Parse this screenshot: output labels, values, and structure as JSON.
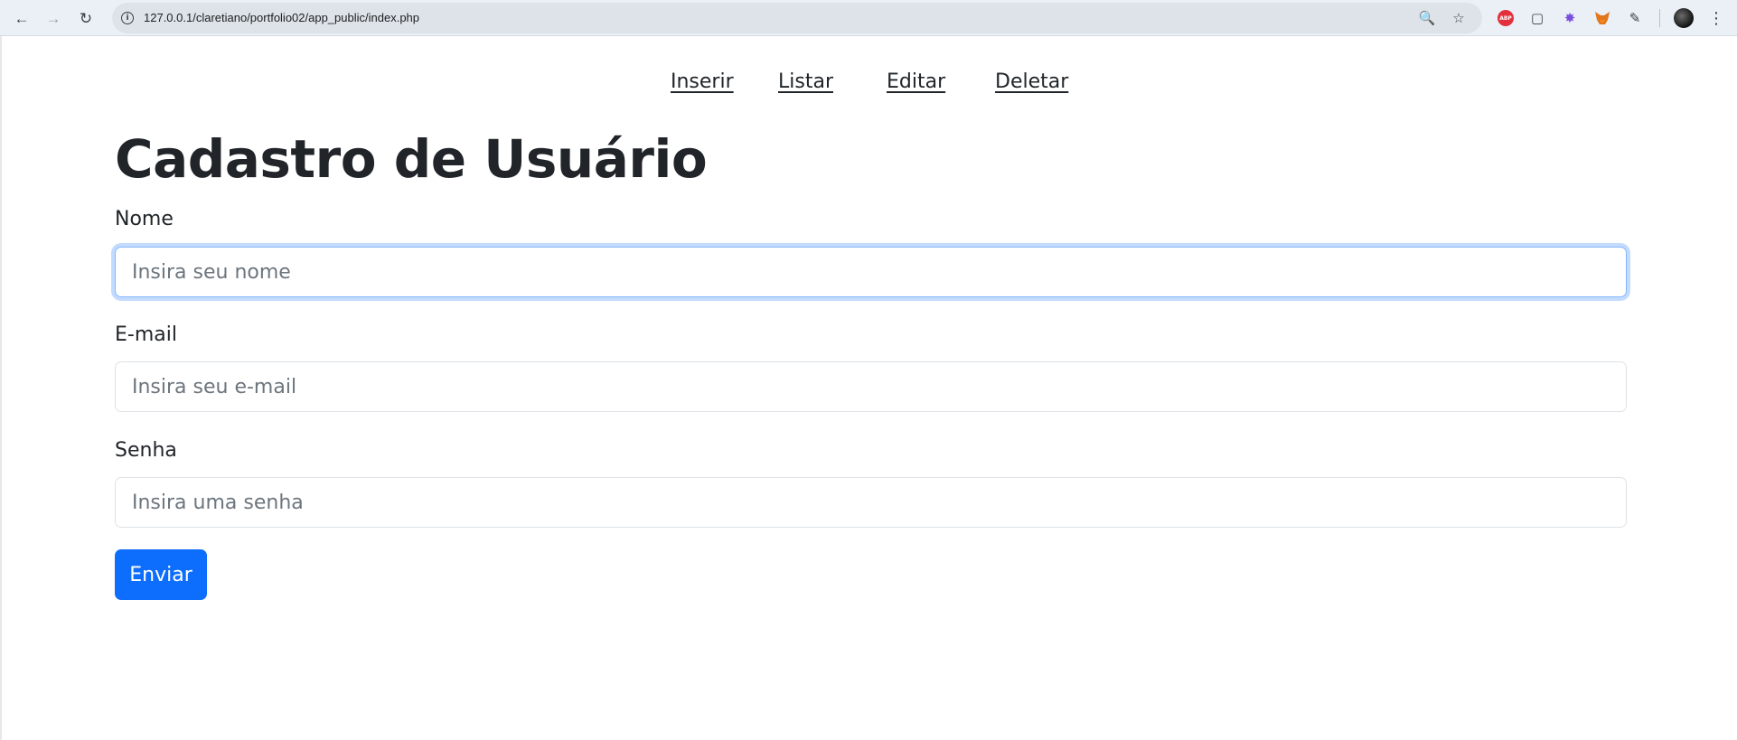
{
  "browser": {
    "url": "127.0.0.1/claretiano/portfolio02/app_public/index.php",
    "icons": {
      "back": "arrow-left-icon",
      "forward": "arrow-right-icon",
      "reload": "reload-icon",
      "site_info": "info-icon",
      "zoom": "zoom-icon",
      "bookmark": "star-icon",
      "extensions": [
        "adblock-plus-icon",
        "screenshot-icon",
        "flower-extension-icon",
        "metamask-fox-icon",
        "puzzle-icon"
      ],
      "profile": "avatar",
      "menu": "kebab-menu-icon"
    },
    "abp_text": "ABP"
  },
  "nav": {
    "links": [
      {
        "label": "Inserir"
      },
      {
        "label": "Listar"
      },
      {
        "label": "Editar"
      },
      {
        "label": "Deletar"
      }
    ]
  },
  "page": {
    "title": "Cadastro de Usuário"
  },
  "form": {
    "name": {
      "label": "Nome",
      "placeholder": "Insira seu nome",
      "value": ""
    },
    "email": {
      "label": "E-mail",
      "placeholder": "Insira seu e-mail",
      "value": ""
    },
    "password": {
      "label": "Senha",
      "placeholder": "Insira uma senha",
      "value": ""
    },
    "submit_label": "Enviar"
  },
  "colors": {
    "primary": "#0d6efd",
    "text": "#212529",
    "placeholder": "#6c757d",
    "focus_ring": "#86b7fe"
  }
}
